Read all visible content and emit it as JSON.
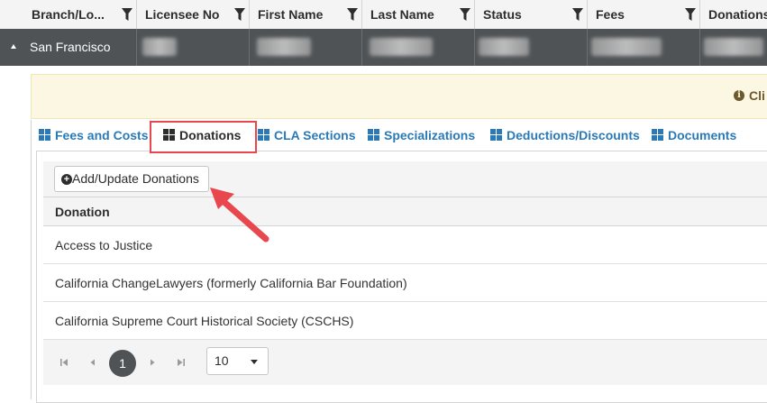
{
  "grid": {
    "columns": [
      "Branch/Lo...",
      "Licensee No",
      "First Name",
      "Last Name",
      "Status",
      "Fees",
      "Donations"
    ],
    "group_row_label": "San Francisco"
  },
  "notice": {
    "text": "Cli"
  },
  "tabs": [
    {
      "label": "Fees and Costs",
      "active": false
    },
    {
      "label": "Donations",
      "active": true
    },
    {
      "label": "CLA Sections",
      "active": false
    },
    {
      "label": "Specializations",
      "active": false
    },
    {
      "label": "Deductions/Discounts",
      "active": false
    },
    {
      "label": "Documents",
      "active": false
    }
  ],
  "donations": {
    "add_button_label": "Add/Update Donations",
    "column_header": "Donation",
    "rows": [
      "Access to Justice",
      "California ChangeLawyers (formerly California Bar Foundation)",
      "California Supreme Court Historical Society (CSCHS)"
    ]
  },
  "pager": {
    "current_page": "1",
    "page_size": "10"
  },
  "colors": {
    "accent_tab": "#2a7ab8",
    "highlight": "#e8484d",
    "group_row_bg": "#4f5356"
  }
}
